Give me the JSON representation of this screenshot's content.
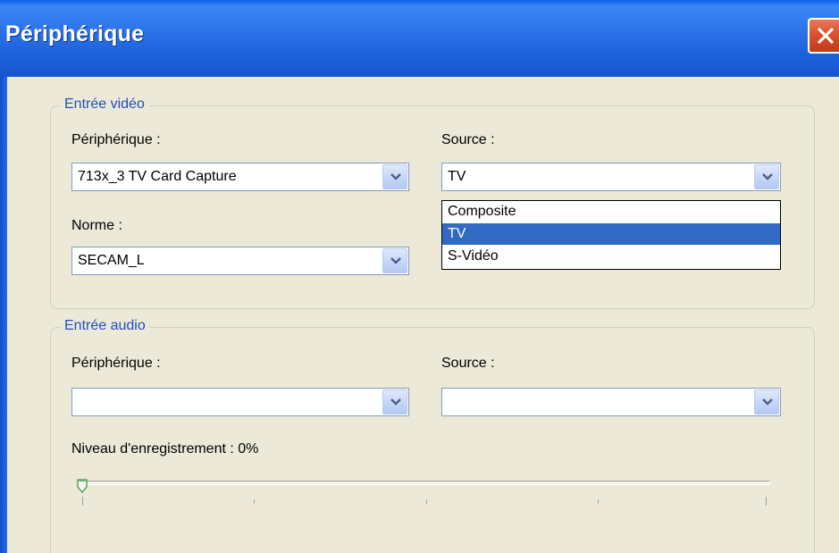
{
  "window": {
    "title": "Périphérique"
  },
  "video_input": {
    "legend": "Entrée vidéo",
    "device_label": "Périphérique :",
    "device_value": "713x_3 TV Card Capture",
    "source_label": "Source :",
    "source_value": "TV",
    "norm_label": "Norme :",
    "norm_value": "SECAM_L",
    "source_options": [
      "Composite",
      "TV",
      "S-Vidéo"
    ],
    "source_selected": "TV"
  },
  "audio_input": {
    "legend": "Entrée audio",
    "device_label": "Périphérique :",
    "device_value": "",
    "source_label": "Source :",
    "source_value": "",
    "level_label": "Niveau d'enregistrement : 0%",
    "level_percent": 0
  },
  "colors": {
    "title_bar": "#2a70e8",
    "selection": "#316ac5",
    "legend_text": "#1f4fbf",
    "close_button": "#d9512f"
  },
  "icons": {
    "close": "close-icon",
    "dropdown": "chevron-down-icon",
    "slider_thumb": "slider-thumb"
  }
}
